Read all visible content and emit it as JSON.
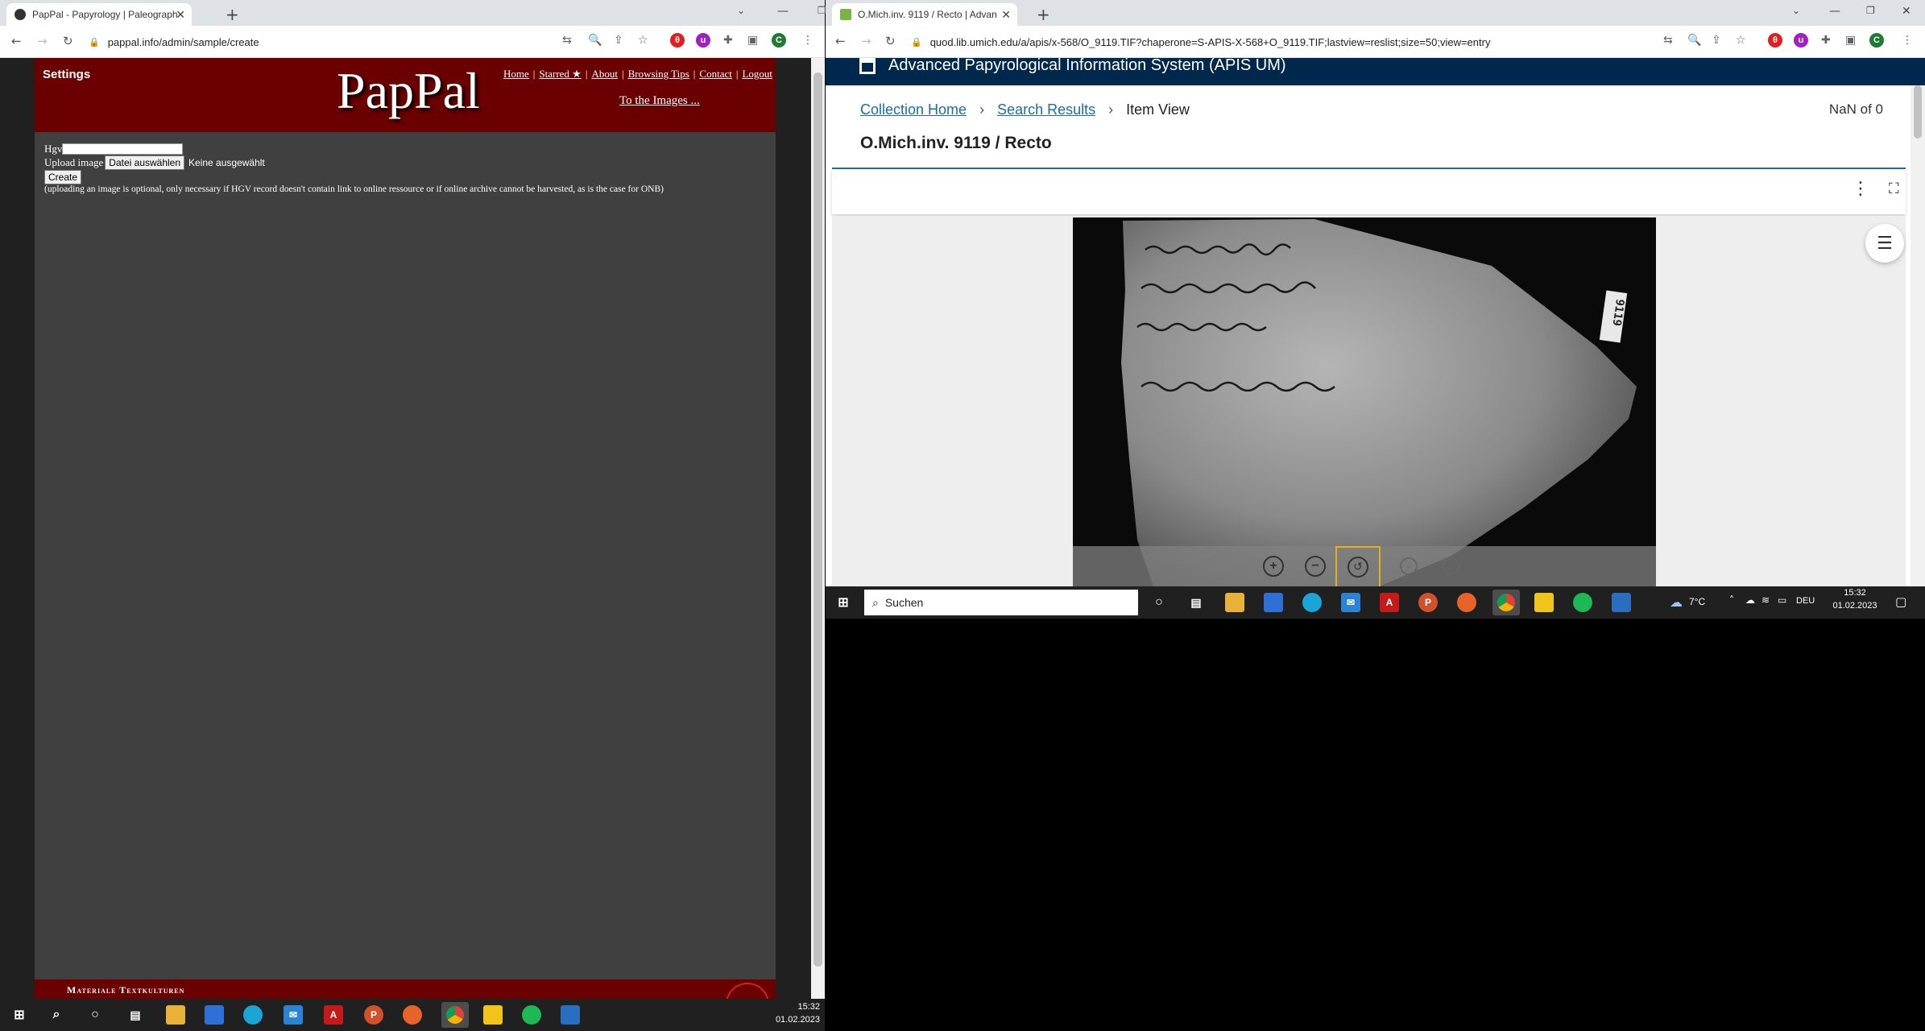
{
  "left_browser": {
    "tab_title": "PapPal - Papyrology | Paleograph",
    "url": "pappal.info/admin/sample/create",
    "profile_initial": "C"
  },
  "pappal": {
    "settings": "Settings",
    "logo": "PapPal",
    "nav": [
      "Home",
      "Starred ★",
      "About",
      "Browsing Tips",
      "Contact",
      "Logout"
    ],
    "to_images": "To the Images ...",
    "form": {
      "hgv_label": "Hgv",
      "hgv_value": "",
      "upload_label": "Upload image",
      "file_button": "Datei auswählen",
      "file_status": "Keine ausgewählt",
      "create_button": "Create",
      "note": "(uploading an image is optional, only necessary if HGV record doesn't contain link to online ressource or if online archive cannot be harvested, as is the case for ONB)"
    },
    "footer_text": "Materiale Textkulturen"
  },
  "right_browser": {
    "tab_title": "O.Mich.inv. 9119 / Recto | Advan",
    "url": "quod.lib.umich.edu/a/apis/x-568/O_9119.TIF?chaperone=S-APIS-X-568+O_9119.TIF;lastview=reslist;size=50;view=entry",
    "profile_initial": "C"
  },
  "apis": {
    "site_title": "Advanced Papyrological Information System (APIS UM)",
    "breadcrumbs": [
      "Collection Home",
      "Search Results",
      "Item View"
    ],
    "pager": "NaN of 0",
    "item_title": "O.Mich.inv. 9119 / Recto",
    "image_label": "9119"
  },
  "taskbar_left": {
    "time": "15:32",
    "date": "01.02.2023"
  },
  "taskbar_right": {
    "search_placeholder": "Suchen",
    "weather": "7°C",
    "language": "DEU",
    "time": "15:32",
    "date": "01.02.2023"
  },
  "colors": {
    "pappal_red": "#6a0000",
    "apis_navy": "#00274c",
    "link_blue": "#1a6cab"
  }
}
